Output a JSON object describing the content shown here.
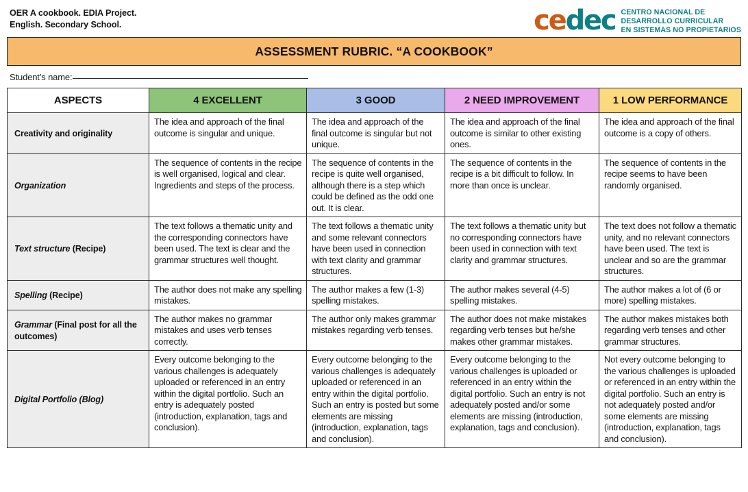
{
  "header": {
    "line1": "OER A cookbook. EDIA Project.",
    "line2": "English. Secondary School.",
    "logo": {
      "word_orange": "ce",
      "word_teal": "dec",
      "tagline_line1": "CENTRO NACIONAL DE",
      "tagline_line2": "DESARROLLO CURRICULAR",
      "tagline_line3": "EN SISTEMAS NO PROPIETARIOS",
      "orange_hex": "#cc5b16",
      "teal_hex": "#0d7f86"
    }
  },
  "banner": {
    "title": "ASSESSMENT RUBRIC. “A COOKBOOK”",
    "bg_hex": "#f7b96b"
  },
  "student": {
    "label": "Student’s name:"
  },
  "table": {
    "headers": [
      {
        "label": "ASPECTS",
        "bg_hex": "#ffffff"
      },
      {
        "label": "4 EXCELLENT",
        "bg_hex": "#8ec37a"
      },
      {
        "label": "3  GOOD",
        "bg_hex": "#a9bde6"
      },
      {
        "label": "2 NEED IMPROVEMENT",
        "bg_hex": "#e9a9ea"
      },
      {
        "label": "1 LOW PERFORMANCE",
        "bg_hex": "#fbd97f"
      }
    ],
    "rows": [
      {
        "aspect_main": "Creativity and originality",
        "aspect_suffix": "",
        "aspect_style": "bold",
        "cells": [
          "The idea and approach of the final outcome is singular and unique.",
          "The idea and approach of the final outcome is singular but not unique.",
          "The idea and approach of the final outcome is similar to other existing ones.",
          "The idea and approach of the final outcome is a copy of others."
        ]
      },
      {
        "aspect_main": "Organization",
        "aspect_suffix": "",
        "aspect_style": "italic",
        "cells": [
          "The sequence of contents in the recipe is well organised, logical and clear. Ingredients and steps of the process.",
          "The sequence of contents in the recipe is quite well organised, although there is a step which could be defined as the odd one out. It is clear.",
          "The sequence of contents in the recipe is a bit difficult to follow. In more than once is unclear.",
          "The sequence of contents in the recipe seems to have been randomly organised."
        ]
      },
      {
        "aspect_main": "Text structure",
        "aspect_suffix": " (Recipe)",
        "aspect_style": "italic",
        "cells": [
          "The text follows a thematic unity and the corresponding connectors have been used. The text is clear and the grammar structures well thought.",
          "The text follows a thematic unity and some relevant connectors have been used in connection with text clarity and grammar structures.",
          "The text follows a thematic unity but no corresponding connectors have been used in connection with text clarity and grammar structures.",
          "The text does not follow a thematic unity, and no relevant connectors have been used. The text is unclear and so are the grammar structures."
        ]
      },
      {
        "aspect_main": "Spelling",
        "aspect_suffix": " (Recipe)",
        "aspect_style": "italic",
        "cells": [
          "The author does not make any spelling mistakes.",
          "The author makes a few (1-3) spelling mistakes.",
          "The author makes several (4-5) spelling mistakes.",
          "The author makes a lot of (6 or more) spelling mistakes."
        ]
      },
      {
        "aspect_main": "Grammar",
        "aspect_suffix": " (Final post for all the outcomes)",
        "aspect_style": "italic",
        "cells": [
          "The author makes no grammar mistakes and uses verb tenses correctly.",
          "The author only makes grammar mistakes regarding verb tenses.",
          "The author does not make mistakes regarding verb tenses but he/she makes other grammar mistakes.",
          "The author makes mistakes both regarding verb tenses and other grammar structures."
        ]
      },
      {
        "aspect_main": "Digital Portfolio (Blog)",
        "aspect_suffix": "",
        "aspect_style": "italic",
        "cells": [
          "Every outcome belonging to the various challenges is adequately uploaded or referenced in an entry within the digital portfolio. Such an entry is adequately posted (introduction, explanation, tags and conclusion).",
          "Every outcome belonging to the various challenges is adequately uploaded or referenced in an entry within the digital portfolio. Such an entry is posted but some elements are missing (introduction, explanation, tags and conclusion).",
          "Every outcome belonging to the various challenges is uploaded or referenced in an entry within the digital portfolio. Such an entry is not adequately posted and/or some elements are missing (introduction, explanation, tags and conclusion).",
          "Not every outcome belonging to the various challenges is uploaded or referenced in an entry within the digital portfolio. Such an entry is not adequately posted and/or some elements are missing (introduction, explanation, tags and conclusion)."
        ]
      }
    ]
  }
}
